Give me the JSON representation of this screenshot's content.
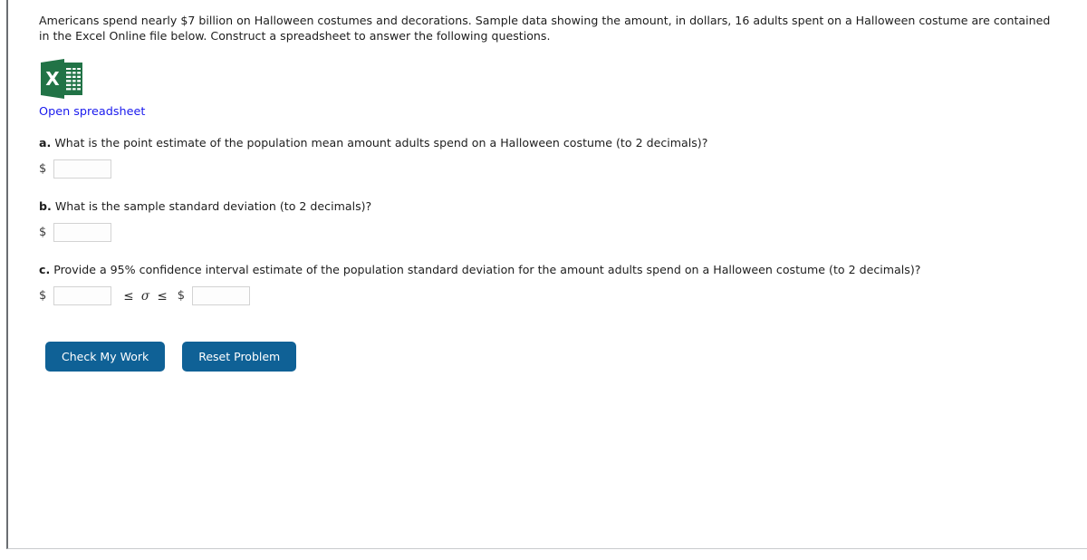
{
  "intro": {
    "text": "Americans spend nearly $7 billion on Halloween costumes and decorations. Sample data showing the amount, in dollars, 16 adults spent on a Halloween costume are contained in the Excel Online file below. Construct a spreadsheet to answer the following questions."
  },
  "spreadsheet": {
    "icon": "excel-icon",
    "icon_letter": "X",
    "link_label": "Open spreadsheet",
    "link_color": "#1a1aee",
    "icon_color": "#217346"
  },
  "questions": [
    {
      "label": "a.",
      "text": "What is the point estimate of the population mean amount adults spend on a Halloween costume (to 2 decimals)?",
      "currency": "$",
      "value": "",
      "placeholder": ""
    },
    {
      "label": "b.",
      "text": "What is the sample standard deviation (to 2 decimals)?",
      "currency": "$",
      "value": "",
      "placeholder": ""
    },
    {
      "label": "c.",
      "text": "Provide a 95% confidence interval estimate of the population standard deviation for the amount adults spend on a Halloween costume (to 2 decimals)?",
      "currency": "$",
      "currency_upper": "$",
      "inequality": "≤ σ ≤",
      "value_lower": "",
      "value_upper": "",
      "placeholder": ""
    }
  ],
  "buttons": {
    "check_label": "Check My Work",
    "reset_label": "Reset Problem",
    "color": "#0f6196",
    "text_color": "#ffffff"
  }
}
